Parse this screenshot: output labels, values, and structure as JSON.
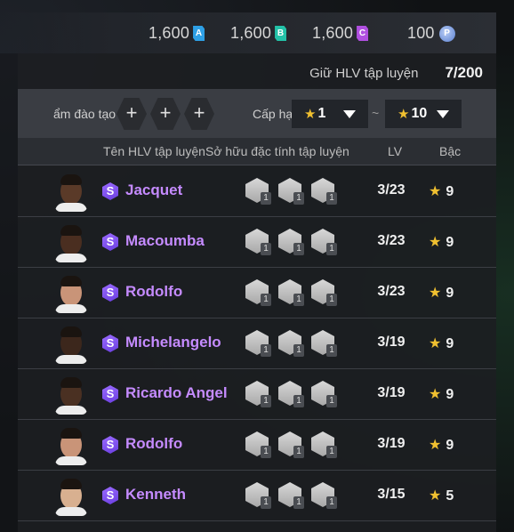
{
  "currencies": [
    {
      "value": "1,600",
      "badge": "A",
      "color": "#2ea0e6"
    },
    {
      "value": "1,600",
      "badge": "B",
      "color": "#23c2a8"
    },
    {
      "value": "1,600",
      "badge": "C",
      "color": "#b04fe0"
    },
    {
      "value": "100",
      "badge": "P",
      "color": "#6a8fe0",
      "icon": "p-coin-icon"
    }
  ],
  "header": {
    "label": "Giữ HLV tập luyện",
    "count": "7/200"
  },
  "filter": {
    "training_label": "ẩm đào tạo",
    "add_slots": [
      "+",
      "+",
      "+"
    ],
    "grade_label": "Cấp hạ",
    "from_value": "1",
    "to_value": "10",
    "separator": "~"
  },
  "columns": {
    "name": "Tên HLV tập luyện",
    "traits": "Sở hữu đặc tính tập luyện",
    "lv": "LV",
    "grade": "Bậc"
  },
  "rows": [
    {
      "name": "Jacquet",
      "lv": "3/23",
      "grade": "9",
      "skin": "#5a3a28",
      "traits": [
        "1",
        "1",
        "1"
      ]
    },
    {
      "name": "Macoumba",
      "lv": "3/23",
      "grade": "9",
      "skin": "#4a2e20",
      "traits": [
        "1",
        "1",
        "1"
      ]
    },
    {
      "name": "Rodolfo",
      "lv": "3/23",
      "grade": "9",
      "skin": "#c99478",
      "traits": [
        "1",
        "1",
        "1"
      ]
    },
    {
      "name": "Michelangelo",
      "lv": "3/19",
      "grade": "9",
      "skin": "#3c271c",
      "traits": [
        "1",
        "1",
        "1"
      ]
    },
    {
      "name": "Ricardo Angel",
      "lv": "3/19",
      "grade": "9",
      "skin": "#4a3022",
      "traits": [
        "1",
        "1",
        "1"
      ]
    },
    {
      "name": "Rodolfo",
      "lv": "3/19",
      "grade": "9",
      "skin": "#c99478",
      "traits": [
        "1",
        "1",
        "1"
      ]
    },
    {
      "name": "Kenneth",
      "lv": "3/15",
      "grade": "5",
      "skin": "#d8b090",
      "traits": [
        "1",
        "1",
        "1"
      ]
    }
  ],
  "grade_star": "★",
  "coach_badge": "S"
}
